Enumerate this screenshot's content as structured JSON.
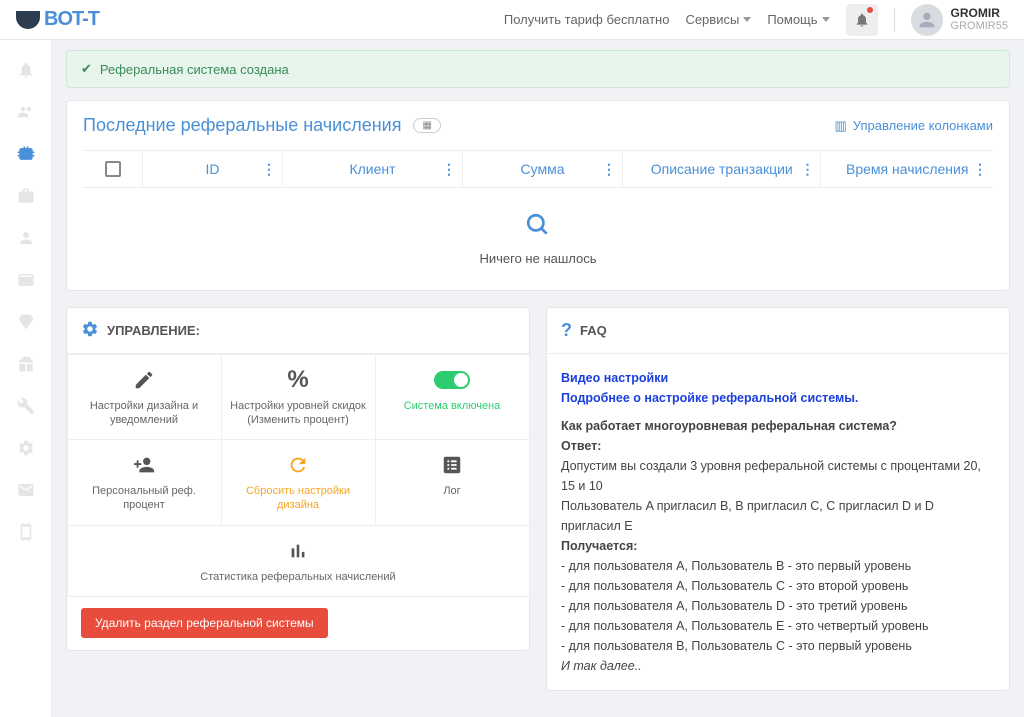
{
  "header": {
    "logo_text": "BOT-T",
    "free_tariff": "Получить тариф бесплатно",
    "services": "Сервисы",
    "help": "Помощь",
    "user_name": "GROMIR",
    "user_sub": "GROMIR55"
  },
  "alert": {
    "message": "Реферальная система создана"
  },
  "table": {
    "title": "Последние реферальные начисления",
    "columns_link": "Управление колонками",
    "cols": {
      "id": "ID",
      "client": "Клиент",
      "sum": "Сумма",
      "desc": "Описание транзакции",
      "time": "Время начисления"
    },
    "empty": "Ничего не нашлось"
  },
  "manage": {
    "title": "УПРАВЛЕНИЕ:",
    "tiles": {
      "design": "Настройки дизайна и уведомлений",
      "discount": "Настройки уровней скидок",
      "discount_sub": "(Изменить процент)",
      "enabled": "Система включена",
      "personal": "Персональный реф. процент",
      "reset": "Сбросить настройки дизайна",
      "log": "Лог",
      "stats": "Статистика реферальных начислений"
    },
    "delete_btn": "Удалить раздел реферальной системы"
  },
  "faq": {
    "title": "FAQ",
    "video_link": "Видео настройки",
    "more_link": "Подробнее о настройке реферальной системы.",
    "q1": "Как работает многоуровневая реферальная система?",
    "answer_label": "Ответ:",
    "p1": "Допустим вы создали 3 уровня реферальной системы с процентами 20, 15 и 10",
    "p2": "Пользователь A пригласил B, B пригласил C, C пригласил D и D пригласил E",
    "p3_label": "Получается:",
    "l1": "- для пользователя A, Пользователь B - это первый уровень",
    "l2": "- для пользователя A, Пользователь C - это второй уровень",
    "l3": "- для пользователя A, Пользователь D - это третий уровень",
    "l4": "- для пользователя A, Пользователь E - это четвертый уровень",
    "l5": "- для пользователя B, Пользователь C - это первый уровень",
    "etc": "И так далее.."
  }
}
